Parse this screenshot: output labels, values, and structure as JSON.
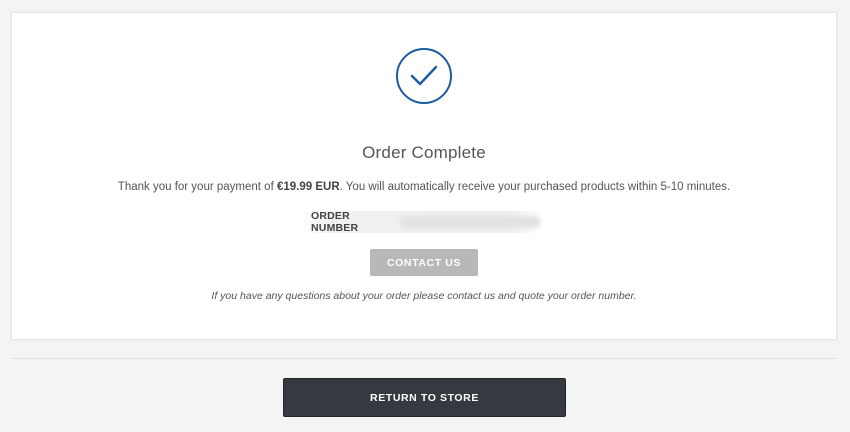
{
  "confirmation": {
    "title": "Order Complete",
    "thanks_prefix": "Thank you for your payment of ",
    "amount": "€19.99 EUR",
    "thanks_suffix": ". You will automatically receive your purchased products within 5-10 minutes.",
    "order_number_label": "ORDER NUMBER",
    "contact_button": "CONTACT US",
    "note": "If you have any questions about your order please contact us and quote your order number.",
    "icon": "checkmark-icon"
  },
  "footer": {
    "return_button": "RETURN TO STORE"
  },
  "colors": {
    "accent": "#1a5d9e",
    "contact_button_bg": "#b8b8b8",
    "return_button_bg": "#353a40"
  }
}
